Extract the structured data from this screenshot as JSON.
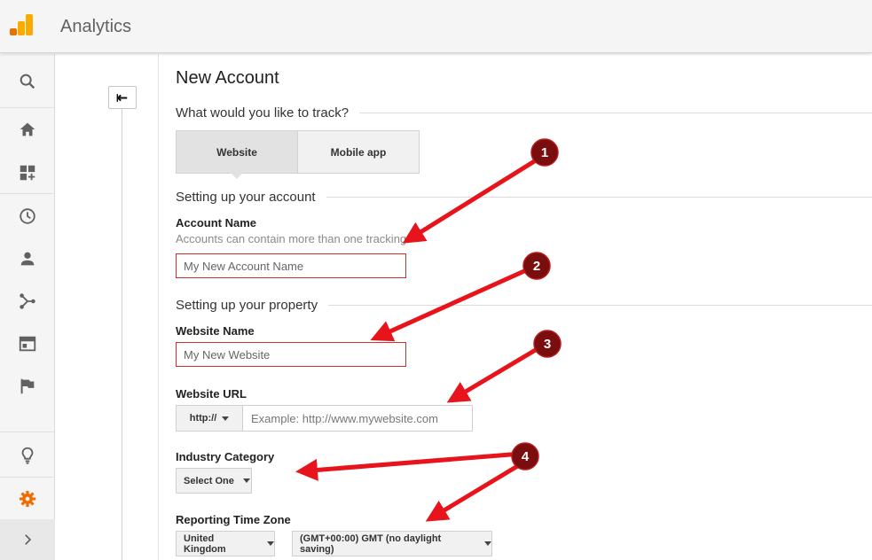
{
  "header": {
    "app_title": "Analytics",
    "logo_icon": "analytics-logo-icon"
  },
  "sidebar": {
    "items": [
      {
        "icon": "search-icon",
        "label": "Search"
      },
      {
        "icon": "home-icon",
        "label": "Home"
      },
      {
        "icon": "customization-icon",
        "label": "Customization"
      },
      {
        "icon": "realtime-clock-icon",
        "label": "Real-time"
      },
      {
        "icon": "audience-person-icon",
        "label": "Audience"
      },
      {
        "icon": "acquisition-icon",
        "label": "Acquisition"
      },
      {
        "icon": "behavior-icon",
        "label": "Behavior"
      },
      {
        "icon": "conversions-flag-icon",
        "label": "Conversions"
      },
      {
        "icon": "discover-lightbulb-icon",
        "label": "Discover"
      },
      {
        "icon": "admin-gear-icon",
        "label": "Admin"
      }
    ],
    "expand_icon": "chevron-right-icon",
    "colors": {
      "active_icon": "#ef6c00",
      "icon": "#616161"
    }
  },
  "admin": {
    "back_icon": "back-arrow-icon"
  },
  "form": {
    "page_title": "New Account",
    "track_section": "What would you like to track?",
    "tabs": [
      "Website",
      "Mobile app"
    ],
    "account_section": "Setting up your account",
    "account_name_label": "Account Name",
    "account_name_hint": "Accounts can contain more than one tracking",
    "account_name_value": "My New Account Name",
    "property_section": "Setting up your property",
    "website_name_label": "Website Name",
    "website_name_value": "My New Website",
    "website_url_label": "Website URL",
    "protocol_value": "http://",
    "website_url_placeholder": "Example: http://www.mywebsite.com",
    "industry_label": "Industry Category",
    "industry_value": "Select One",
    "timezone_label": "Reporting Time Zone",
    "country_value": "United Kingdom",
    "timezone_value": "(GMT+00:00) GMT (no daylight saving)"
  },
  "annotations": {
    "badges": [
      "1",
      "2",
      "3",
      "4"
    ],
    "colors": {
      "arrow": "#e8141b",
      "badge": "#7a0d0d"
    }
  }
}
